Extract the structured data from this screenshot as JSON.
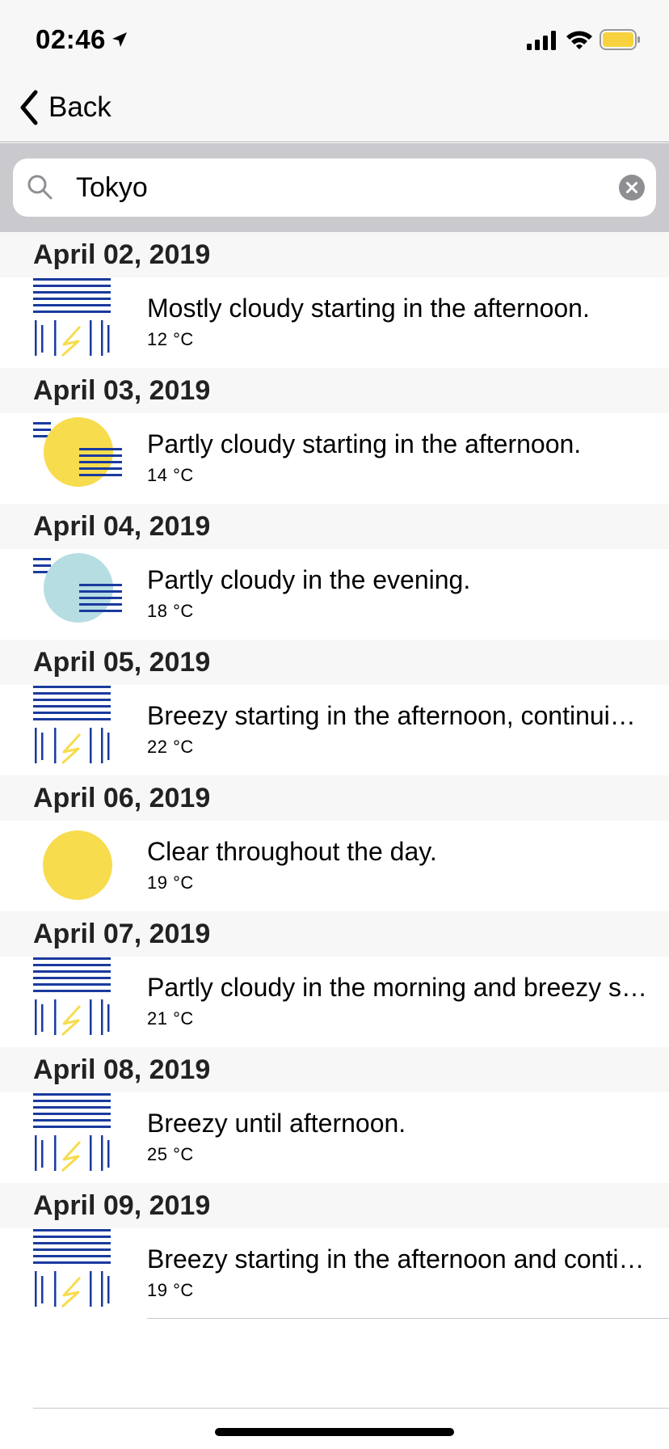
{
  "status_bar": {
    "time": "02:46",
    "location_icon": "location-arrow-icon",
    "signal_icon": "cellular-signal-icon",
    "wifi_icon": "wifi-icon",
    "battery_icon": "battery-icon",
    "battery_color": "#f7d23e"
  },
  "nav": {
    "back_label": "Back",
    "back_icon": "chevron-left-icon"
  },
  "search": {
    "value": "Tokyo",
    "placeholder": "",
    "search_icon": "search-icon",
    "clear_icon": "clear-icon"
  },
  "colors": {
    "rain_blue": "#1a3a9e",
    "sun_yellow": "#f7dc4e",
    "moon_blue": "#b6dde2",
    "section_bg": "#f7f7f7"
  },
  "forecast": [
    {
      "date": "April 02, 2019",
      "summary": "Mostly cloudy starting in the afternoon.",
      "temp": "12 °C",
      "icon": "rain-icon"
    },
    {
      "date": "April 03, 2019",
      "summary": "Partly cloudy starting in the afternoon.",
      "temp": "14 °C",
      "icon": "partly-cloudy-day-icon"
    },
    {
      "date": "April 04, 2019",
      "summary": "Partly cloudy in the evening.",
      "temp": "18 °C",
      "icon": "partly-cloudy-night-icon"
    },
    {
      "date": "April 05, 2019",
      "summary": "Breezy starting in the afternoon, continuing until evening.",
      "temp": "22 °C",
      "icon": "rain-icon"
    },
    {
      "date": "April 06, 2019",
      "summary": "Clear throughout the day.",
      "temp": "19 °C",
      "icon": "clear-day-icon"
    },
    {
      "date": "April 07, 2019",
      "summary": "Partly cloudy in the morning and breezy starting in the afternoon.",
      "temp": "21 °C",
      "icon": "rain-icon"
    },
    {
      "date": "April 08, 2019",
      "summary": "Breezy until afternoon.",
      "temp": "25 °C",
      "icon": "rain-icon"
    },
    {
      "date": "April 09, 2019",
      "summary": "Breezy starting in the afternoon and continuing until evening.",
      "temp": "19 °C",
      "icon": "rain-icon"
    }
  ]
}
